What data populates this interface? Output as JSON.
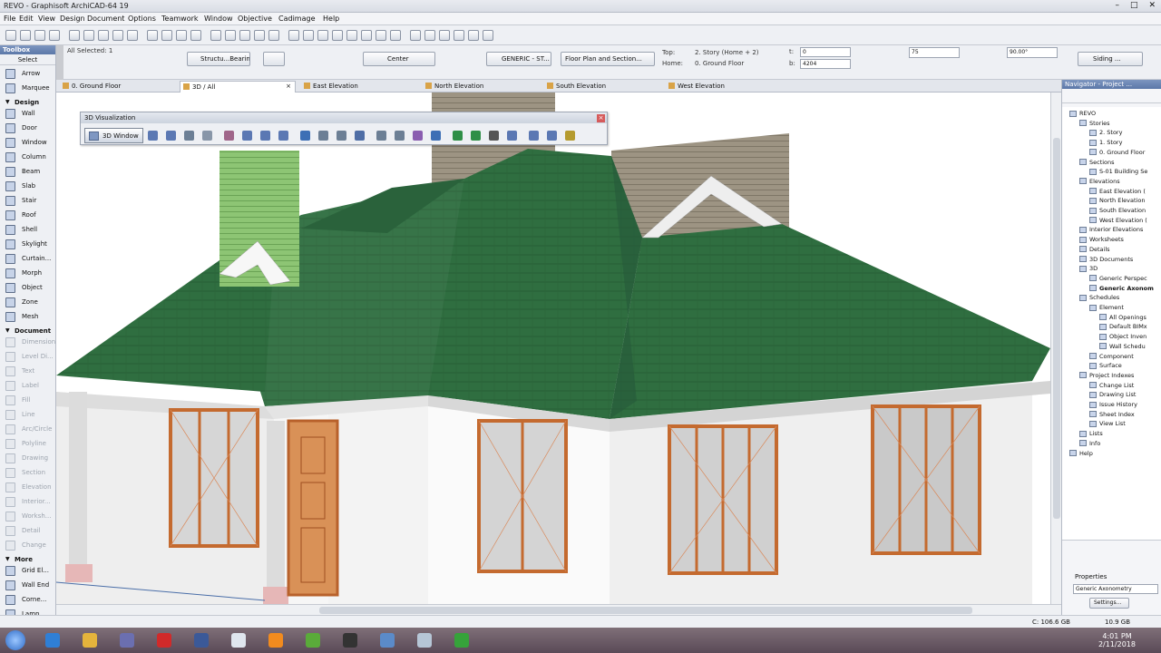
{
  "window": {
    "title": "REVO - Graphisoft ArchiCAD-64 19",
    "controls": [
      "–",
      "□",
      "✕"
    ]
  },
  "menubar": [
    "File",
    "Edit",
    "View",
    "Design",
    "Document",
    "Options",
    "Teamwork",
    "Window",
    "Objective",
    "Cadimage",
    "Help"
  ],
  "infobox": {
    "all_selected": "All Selected: 1",
    "layer_label": "Structu...Bearing",
    "anchor": "Center",
    "material": "GENERIC - ST...",
    "view_mode": "Floor Plan and Section...",
    "top_label": "Top:",
    "top_value": "2. Story (Home + 2)",
    "home_label": "Home:",
    "home_value": "0. Ground Floor",
    "t_label": "t:",
    "t_value": "0",
    "b_label": "b:",
    "b_value": "4204",
    "thickness": "75",
    "angle": "90.00°",
    "siding": "Siding ..."
  },
  "toolbox": {
    "title": "Toolbox",
    "select_label": "Select",
    "items": [
      {
        "label": "Arrow",
        "kind": "tool",
        "icon": "arrow-icon"
      },
      {
        "label": "Marquee",
        "kind": "tool",
        "icon": "marquee-icon"
      },
      {
        "label": "Design",
        "kind": "section"
      },
      {
        "label": "Wall",
        "kind": "tool",
        "icon": "wall-icon"
      },
      {
        "label": "Door",
        "kind": "tool",
        "icon": "door-icon"
      },
      {
        "label": "Window",
        "kind": "tool",
        "icon": "window-icon"
      },
      {
        "label": "Column",
        "kind": "tool",
        "icon": "column-icon"
      },
      {
        "label": "Beam",
        "kind": "tool",
        "icon": "beam-icon"
      },
      {
        "label": "Slab",
        "kind": "tool",
        "icon": "slab-icon"
      },
      {
        "label": "Stair",
        "kind": "tool",
        "icon": "stair-icon"
      },
      {
        "label": "Roof",
        "kind": "tool",
        "icon": "roof-icon"
      },
      {
        "label": "Shell",
        "kind": "tool",
        "icon": "shell-icon"
      },
      {
        "label": "Skylight",
        "kind": "tool",
        "icon": "skylight-icon"
      },
      {
        "label": "Curtain...",
        "kind": "tool",
        "icon": "curtain-wall-icon"
      },
      {
        "label": "Morph",
        "kind": "tool",
        "icon": "morph-icon"
      },
      {
        "label": "Object",
        "kind": "tool",
        "icon": "object-icon"
      },
      {
        "label": "Zone",
        "kind": "tool",
        "icon": "zone-icon"
      },
      {
        "label": "Mesh",
        "kind": "tool",
        "icon": "mesh-icon"
      },
      {
        "label": "Document",
        "kind": "section"
      },
      {
        "label": "Dimension",
        "kind": "dim",
        "icon": "dimension-icon"
      },
      {
        "label": "Level Di...",
        "kind": "dim",
        "icon": "level-dimension-icon"
      },
      {
        "label": "Text",
        "kind": "dim",
        "icon": "text-icon"
      },
      {
        "label": "Label",
        "kind": "dim",
        "icon": "label-icon"
      },
      {
        "label": "Fill",
        "kind": "dim",
        "icon": "fill-icon"
      },
      {
        "label": "Line",
        "kind": "dim",
        "icon": "line-icon"
      },
      {
        "label": "Arc/Circle",
        "kind": "dim",
        "icon": "arc-icon"
      },
      {
        "label": "Polyline",
        "kind": "dim",
        "icon": "polyline-icon"
      },
      {
        "label": "Drawing",
        "kind": "dim",
        "icon": "drawing-icon"
      },
      {
        "label": "Section",
        "kind": "dim",
        "icon": "section-icon"
      },
      {
        "label": "Elevation",
        "kind": "dim",
        "icon": "elevation-icon"
      },
      {
        "label": "Interior...",
        "kind": "dim",
        "icon": "interior-elevation-icon"
      },
      {
        "label": "Worksh...",
        "kind": "dim",
        "icon": "worksheet-icon"
      },
      {
        "label": "Detail",
        "kind": "dim",
        "icon": "detail-icon"
      },
      {
        "label": "Change",
        "kind": "dim",
        "icon": "change-icon"
      },
      {
        "label": "More",
        "kind": "section"
      },
      {
        "label": "Grid El...",
        "kind": "tool",
        "icon": "grid-element-icon"
      },
      {
        "label": "Wall End",
        "kind": "tool",
        "icon": "wall-end-icon"
      },
      {
        "label": "Corne...",
        "kind": "tool",
        "icon": "corner-window-icon"
      },
      {
        "label": "Lamp",
        "kind": "tool",
        "icon": "lamp-icon"
      }
    ]
  },
  "tabs": [
    {
      "label": "0. Ground Floor"
    },
    {
      "label": "3D / All",
      "active": true
    },
    {
      "label": "East Elevation"
    },
    {
      "label": "North Elevation"
    },
    {
      "label": "South Elevation"
    },
    {
      "label": "West Elevation"
    }
  ],
  "viz_palette": {
    "title": "3D Visualization",
    "window_button": "3D Window"
  },
  "navigator": {
    "title": "Navigator - Project ...",
    "tree": [
      {
        "label": "REVO",
        "level": 0
      },
      {
        "label": "Stories",
        "level": 1
      },
      {
        "label": "2. Story",
        "level": 2
      },
      {
        "label": "1. Story",
        "level": 2
      },
      {
        "label": "0. Ground Floor",
        "level": 2
      },
      {
        "label": "Sections",
        "level": 1
      },
      {
        "label": "S-01 Building Se",
        "level": 2
      },
      {
        "label": "Elevations",
        "level": 1
      },
      {
        "label": "East Elevation (",
        "level": 2
      },
      {
        "label": "North Elevation",
        "level": 2
      },
      {
        "label": "South Elevation",
        "level": 2
      },
      {
        "label": "West Elevation (",
        "level": 2
      },
      {
        "label": "Interior Elevations",
        "level": 1
      },
      {
        "label": "Worksheets",
        "level": 1
      },
      {
        "label": "Details",
        "level": 1
      },
      {
        "label": "3D Documents",
        "level": 1
      },
      {
        "label": "3D",
        "level": 1
      },
      {
        "label": "Generic Perspec",
        "level": 2
      },
      {
        "label": "Generic Axonom",
        "level": 2,
        "bold": true
      },
      {
        "label": "Schedules",
        "level": 1
      },
      {
        "label": "Element",
        "level": 2
      },
      {
        "label": "All Openings",
        "level": 3
      },
      {
        "label": "Default BIMx",
        "level": 3
      },
      {
        "label": "Object Inven",
        "level": 3
      },
      {
        "label": "Wall Schedu",
        "level": 3
      },
      {
        "label": "Component",
        "level": 2
      },
      {
        "label": "Surface",
        "level": 2
      },
      {
        "label": "Project Indexes",
        "level": 1
      },
      {
        "label": "Change List",
        "level": 2
      },
      {
        "label": "Drawing List",
        "level": 2
      },
      {
        "label": "Issue History",
        "level": 2
      },
      {
        "label": "Sheet Index",
        "level": 2
      },
      {
        "label": "View List",
        "level": 2
      },
      {
        "label": "Lists",
        "level": 1
      },
      {
        "label": "Info",
        "level": 1
      },
      {
        "label": "Help",
        "level": 0
      }
    ],
    "properties_label": "Properties",
    "view_name": "Generic Axonometry",
    "settings_button": "Settings..."
  },
  "statusbar": {
    "disk_c": "C: 106.6 GB",
    "memory": "10.9 GB"
  },
  "taskbar": {
    "apps": [
      "internet-explorer-icon",
      "file-explorer-icon",
      "media-player-icon",
      "opera-icon",
      "facebook-icon",
      "chrome-icon",
      "vlc-icon",
      "app-v-icon",
      "archicad-icon",
      "app-window-icon",
      "app-pale-icon",
      "app-c-icon"
    ],
    "time": "4:01 PM",
    "date": "2/11/2018"
  },
  "colors": {
    "roof": "#2e6d3f",
    "wall": "#f2f2f2",
    "window_frame": "#c46a2f",
    "chimney_green": "#8cc472",
    "chimney_beige": "#9c9482"
  }
}
